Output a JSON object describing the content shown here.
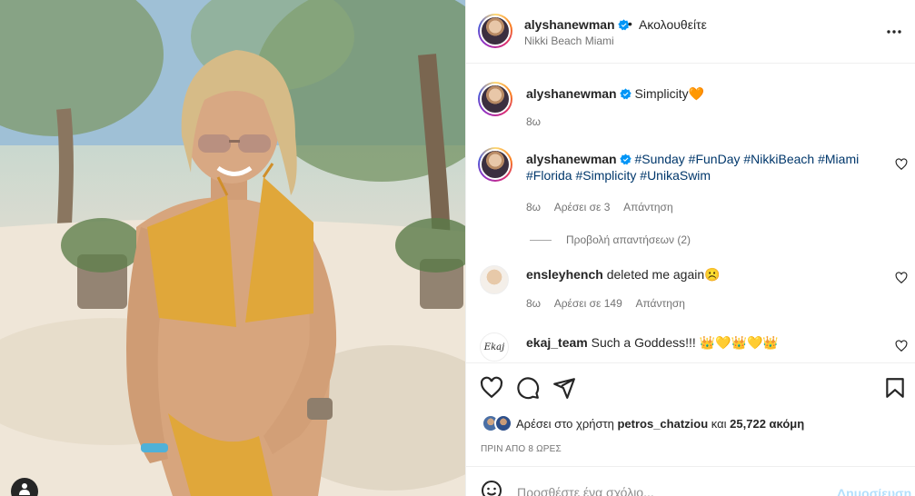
{
  "post": {
    "username": "alyshanewman",
    "follow_dot": "•",
    "follow_state": "Ακολουθείτε",
    "location": "Nikki Beach Miami"
  },
  "caption": {
    "username": "alyshanewman",
    "text": "Simplicity",
    "emoji": "🧡",
    "time": "8ω"
  },
  "comments": [
    {
      "username": "alyshanewman",
      "hashtags": [
        "#Sunday",
        "#FunDay",
        "#NikkiBeach",
        "#Miami",
        "#Florida",
        "#Simplicity",
        "#UnikaSwim"
      ],
      "time": "8ω",
      "likes": "Αρέσει σε 3",
      "reply": "Απάντηση",
      "view_replies": "Προβολή απαντήσεων (2)"
    },
    {
      "username": "ensleyhench",
      "text": "deleted me again",
      "emoji": "☹️",
      "time": "8ω",
      "likes": "Αρέσει σε 149",
      "reply": "Απάντηση"
    },
    {
      "username": "ekaj_team",
      "avatar_text": "Ekaj",
      "text": "Such a Goddess!!!",
      "emoji": "👑💛👑💛👑"
    }
  ],
  "likes": {
    "prefix": "Αρέσει στο χρήστη",
    "user": "petros_chatziou",
    "middle": "και",
    "count": "25,722 ακόμη"
  },
  "time_ago": "ΠΡΙΝ ΑΠΟ 8 ΩΡΕΣ",
  "add_comment": {
    "placeholder": "Προσθέστε ένα σχόλιο...",
    "publish": "Δημοσίευση"
  },
  "colors": {
    "verified": "#0095f6",
    "hashtag": "#00376b",
    "publish_disabled": "#b2dffc",
    "swimsuit": "#e0a73a"
  },
  "icons": [
    "more-options-icon",
    "verified-badge-icon",
    "heart-icon",
    "comment-icon",
    "share-icon",
    "bookmark-icon",
    "emoji-icon",
    "user-icon"
  ]
}
